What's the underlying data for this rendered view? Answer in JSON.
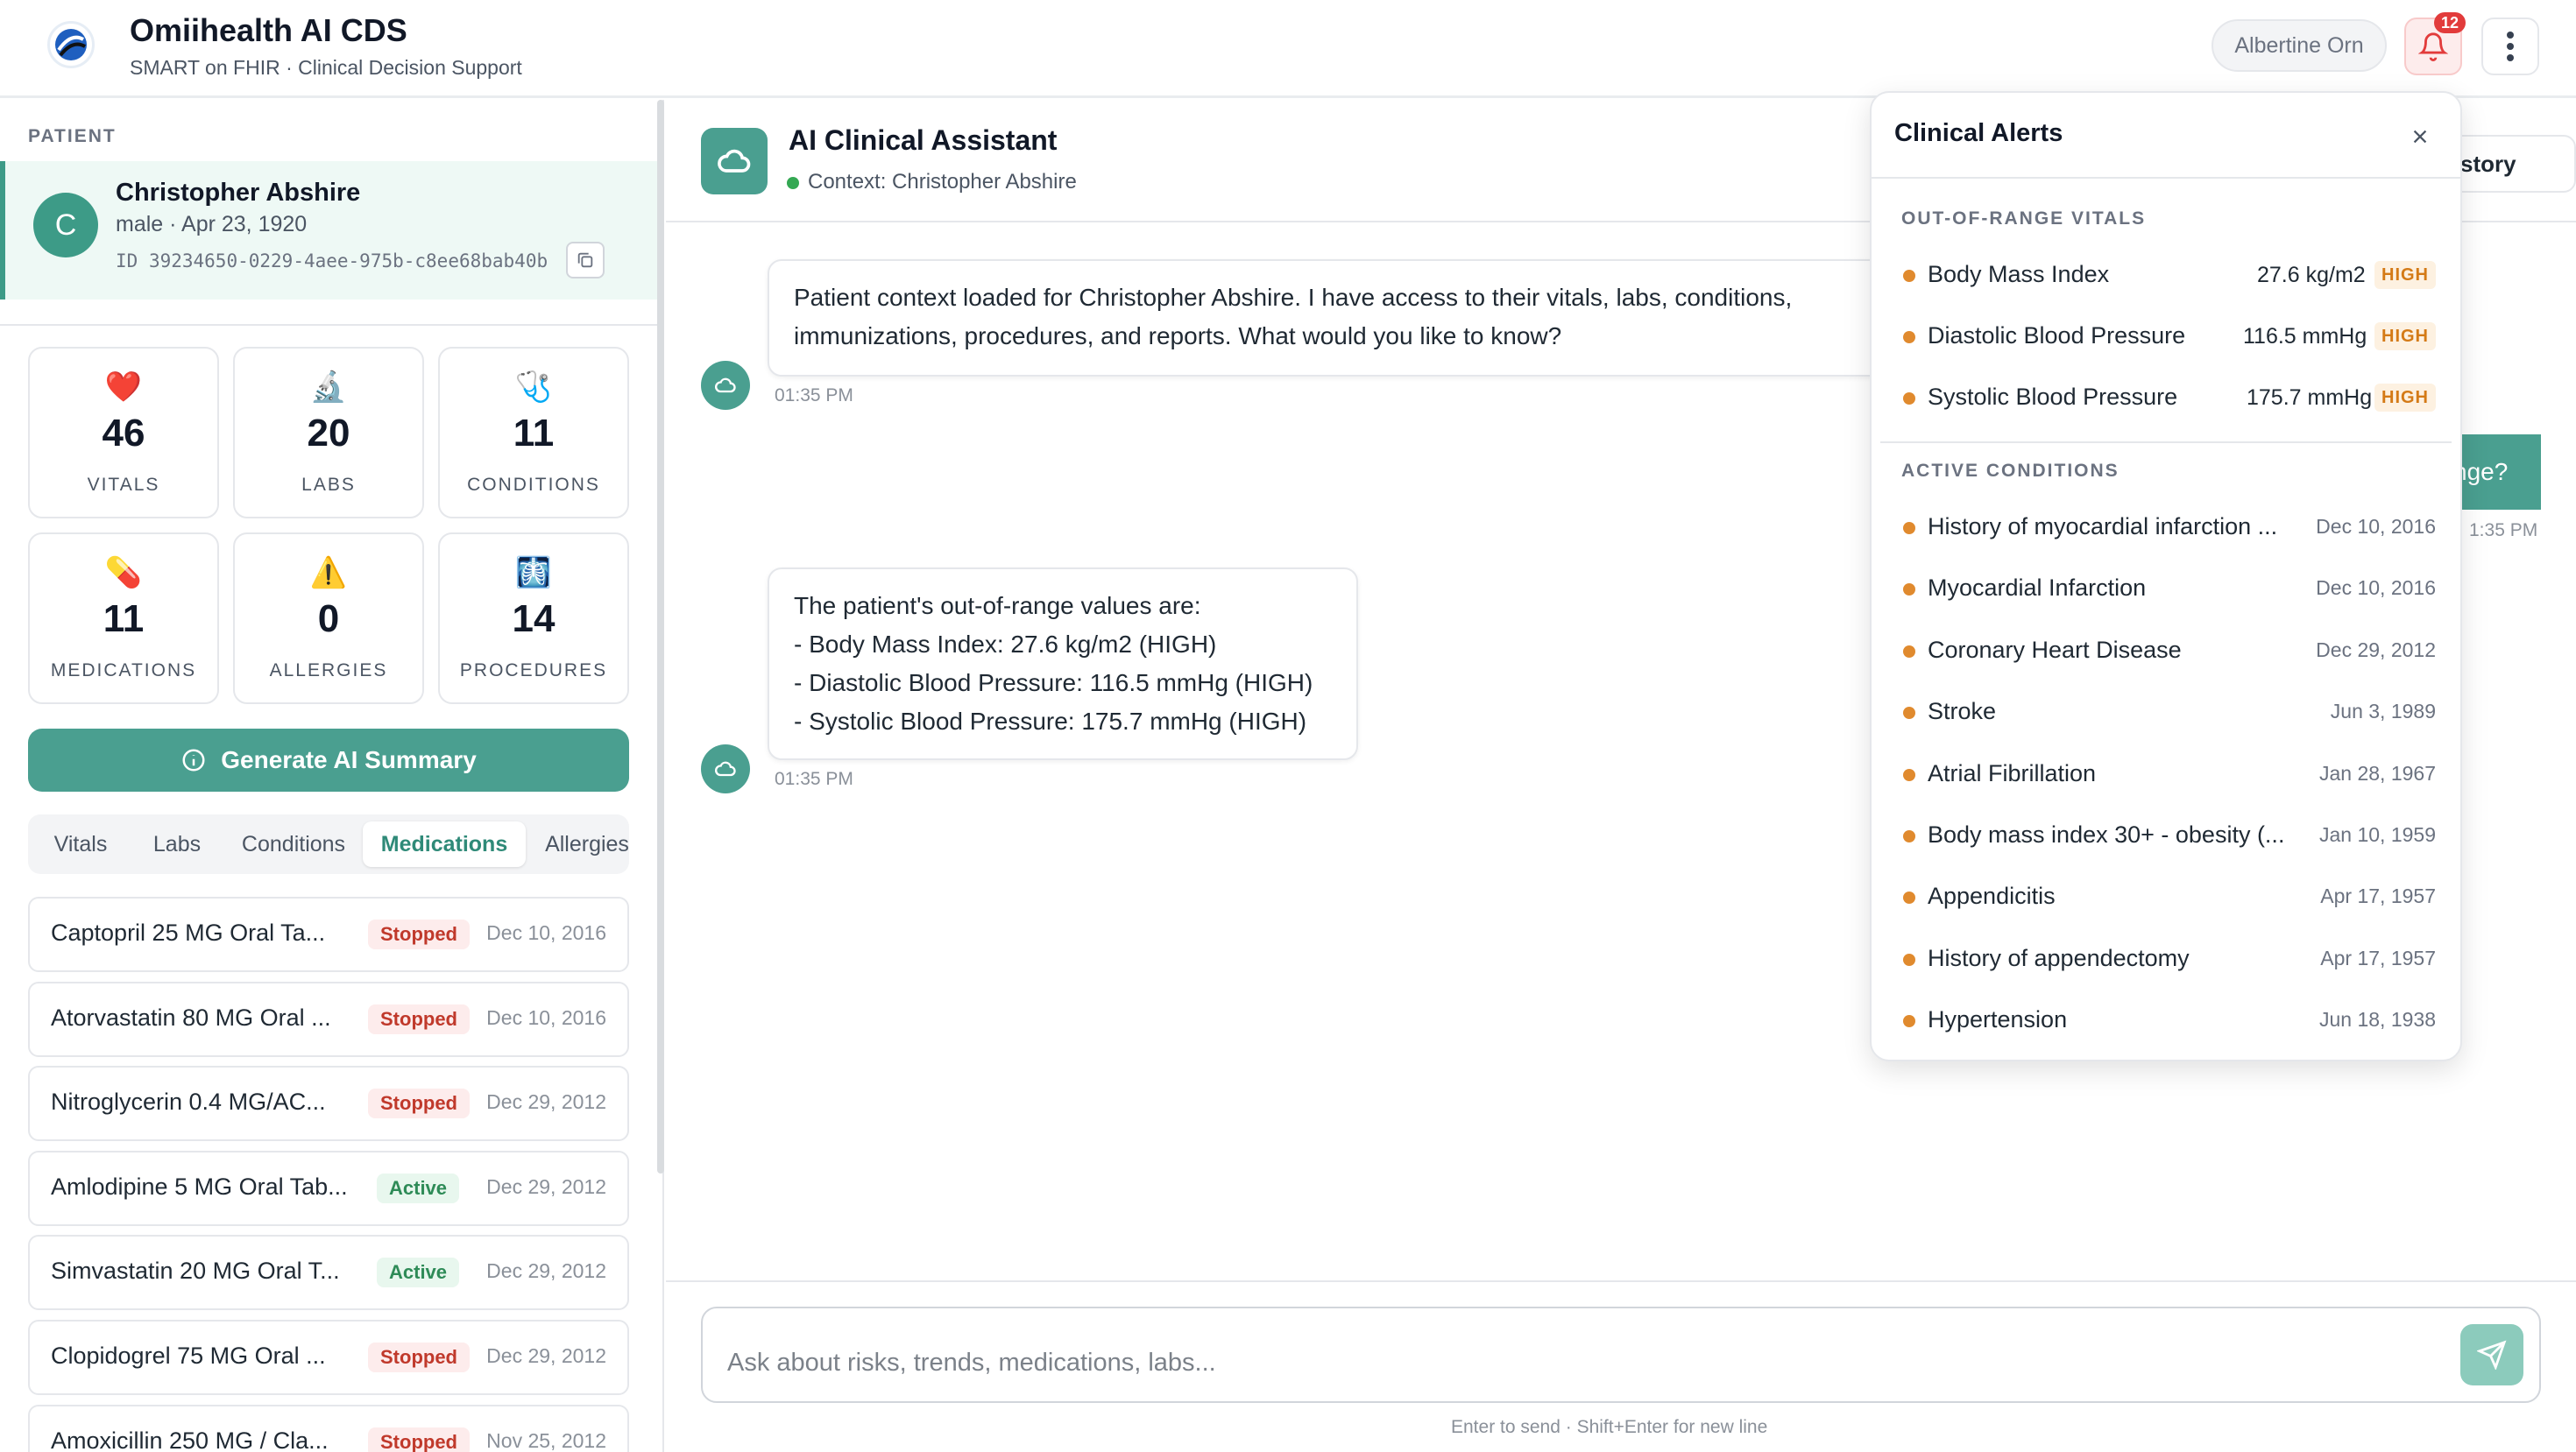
{
  "app": {
    "title": "Omiihealth AI CDS",
    "subtitle": "SMART on FHIR · Clinical Decision Support",
    "user": "Albertine Orn",
    "notification_count": "12"
  },
  "sidebar": {
    "section_label": "PATIENT",
    "patient": {
      "initial": "C",
      "name": "Christopher Abshire",
      "meta": "male · Apr 23, 1920",
      "id_label": "ID",
      "id": "39234650-0229-4aee-975b-c8ee68bab40b"
    },
    "stats": [
      {
        "icon": "❤️",
        "icon_name": "heart-icon",
        "value": "46",
        "label": "VITALS"
      },
      {
        "icon": "🔬",
        "icon_name": "microscope-icon",
        "value": "20",
        "label": "LABS"
      },
      {
        "icon": "🩺",
        "icon_name": "stethoscope-icon",
        "value": "11",
        "label": "CONDITIONS"
      },
      {
        "icon": "💊",
        "icon_name": "pill-icon",
        "value": "11",
        "label": "MEDICATIONS"
      },
      {
        "icon": "⚠️",
        "icon_name": "warning-icon",
        "value": "0",
        "label": "ALLERGIES"
      },
      {
        "icon": "🩻",
        "icon_name": "xray-icon",
        "value": "14",
        "label": "PROCEDURES"
      }
    ],
    "generate_label": "Generate AI Summary",
    "tabs": [
      "Vitals",
      "Labs",
      "Conditions",
      "Medications",
      "Allergies"
    ],
    "active_tab": "Medications",
    "medications": [
      {
        "name": "Captopril 25 MG Oral Ta...",
        "status": "Stopped",
        "date": "Dec 10, 2016"
      },
      {
        "name": "Atorvastatin 80 MG Oral ...",
        "status": "Stopped",
        "date": "Dec 10, 2016"
      },
      {
        "name": "Nitroglycerin 0.4 MG/AC...",
        "status": "Stopped",
        "date": "Dec 29, 2012"
      },
      {
        "name": "Amlodipine 5 MG Oral Tab...",
        "status": "Active",
        "date": "Dec 29, 2012"
      },
      {
        "name": "Simvastatin 20 MG Oral T...",
        "status": "Active",
        "date": "Dec 29, 2012"
      },
      {
        "name": "Clopidogrel 75 MG Oral ...",
        "status": "Stopped",
        "date": "Dec 29, 2012"
      },
      {
        "name": "Amoxicillin 250 MG / Cla...",
        "status": "Stopped",
        "date": "Nov 25, 2012"
      }
    ]
  },
  "chat": {
    "title": "AI Clinical Assistant",
    "context": "Context: Christopher Abshire",
    "history_label": "story",
    "messages": [
      {
        "text": "Patient context loaded for Christopher Abshire. I have access to their vitals, labs, conditions,\nimmunizations, procedures, and reports. What would you like to know?",
        "time": "01:35 PM"
      },
      {
        "text": "The patient's out-of-range values are:\n- Body Mass Index: 27.6 kg/m2 (HIGH)\n- Diastolic Blood Pressure: 116.5 mmHg (HIGH)\n- Systolic Blood Pressure: 175.7 mmHg (HIGH)",
        "time": "01:35 PM"
      }
    ],
    "user_message_visible": "nge?",
    "user_time_visible": "1:35 PM",
    "input_placeholder": "Ask about risks, trends, medications, labs...",
    "hint": "Enter to send · Shift+Enter for new line"
  },
  "alerts": {
    "title": "Clinical Alerts",
    "vitals_heading": "OUT-OF-RANGE VITALS",
    "vitals": [
      {
        "name": "Body Mass Index",
        "value": "27.6 kg/m2",
        "flag": "HIGH"
      },
      {
        "name": "Diastolic Blood Pressure",
        "value": "116.5 mmHg",
        "flag": "HIGH"
      },
      {
        "name": "Systolic Blood Pressure",
        "value": "175.7 mmHg",
        "flag": "HIGH"
      }
    ],
    "conditions_heading": "ACTIVE CONDITIONS",
    "conditions": [
      {
        "name": "History of myocardial infarction ...",
        "date": "Dec 10, 2016"
      },
      {
        "name": "Myocardial Infarction",
        "date": "Dec 10, 2016"
      },
      {
        "name": "Coronary Heart Disease",
        "date": "Dec 29, 2012"
      },
      {
        "name": "Stroke",
        "date": "Jun 3, 1989"
      },
      {
        "name": "Atrial Fibrillation",
        "date": "Jan 28, 1967"
      },
      {
        "name": "Body mass index 30+ - obesity (...",
        "date": "Jan 10, 1959"
      },
      {
        "name": "Appendicitis",
        "date": "Apr 17, 1957"
      },
      {
        "name": "History of appendectomy",
        "date": "Apr 17, 1957"
      },
      {
        "name": "Hypertension",
        "date": "Jun 18, 1938"
      }
    ]
  },
  "colors": {
    "accent": "#4a9f90",
    "stopped": "#c0392b",
    "active": "#2e8b57",
    "high": "#d47a16",
    "alert_dot": "#e08a2e"
  }
}
